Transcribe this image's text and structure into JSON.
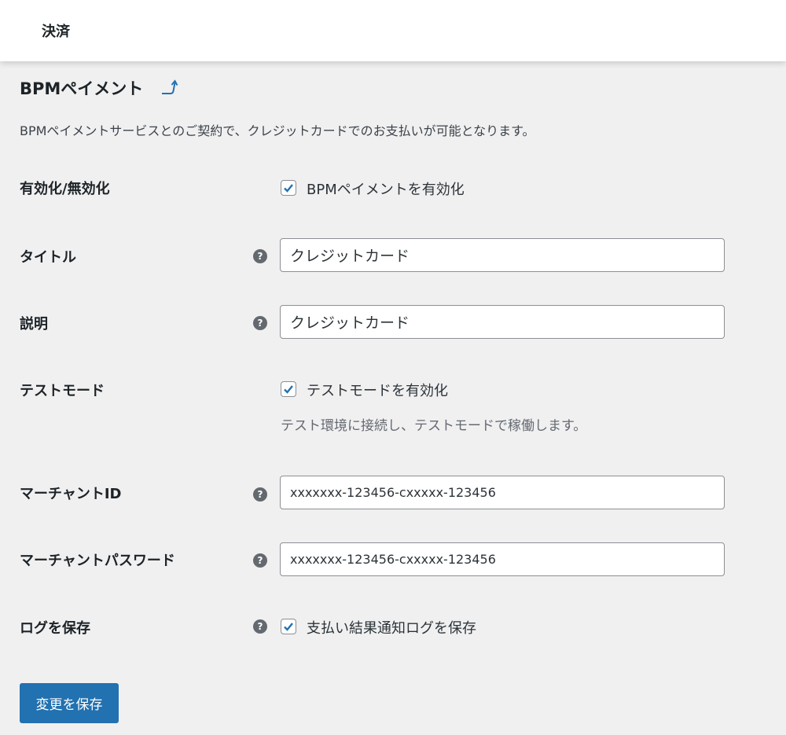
{
  "header": {
    "title": "決済"
  },
  "section": {
    "heading": "BPMペイメント",
    "back_icon": "return-arrow-icon",
    "description": "BPMペイメントサービスとのご契約で、クレジットカードでのお支払いが可能となります。"
  },
  "fields": {
    "enable": {
      "label": "有効化/無効化",
      "checkbox_label": "BPMペイメントを有効化",
      "checked": true
    },
    "title": {
      "label": "タイトル",
      "value": "クレジットカード"
    },
    "description": {
      "label": "説明",
      "value": "クレジットカード"
    },
    "testmode": {
      "label": "テストモード",
      "checkbox_label": "テストモードを有効化",
      "checked": true,
      "hint": "テスト環境に接続し、テストモードで稼働します。"
    },
    "merchant_id": {
      "label": "マーチャントID",
      "value": "xxxxxxx-123456-cxxxxx-123456"
    },
    "merchant_password": {
      "label": "マーチャントパスワード",
      "value": "xxxxxxx-123456-cxxxxx-123456"
    },
    "log": {
      "label": "ログを保存",
      "checkbox_label": "支払い結果通知ログを保存",
      "checked": true
    }
  },
  "help_icon": "?",
  "save_button": {
    "label": "変更を保存"
  },
  "colors": {
    "accent": "#2271b1",
    "background": "#f0f0f1",
    "text": "#1d2327",
    "muted": "#646970"
  }
}
